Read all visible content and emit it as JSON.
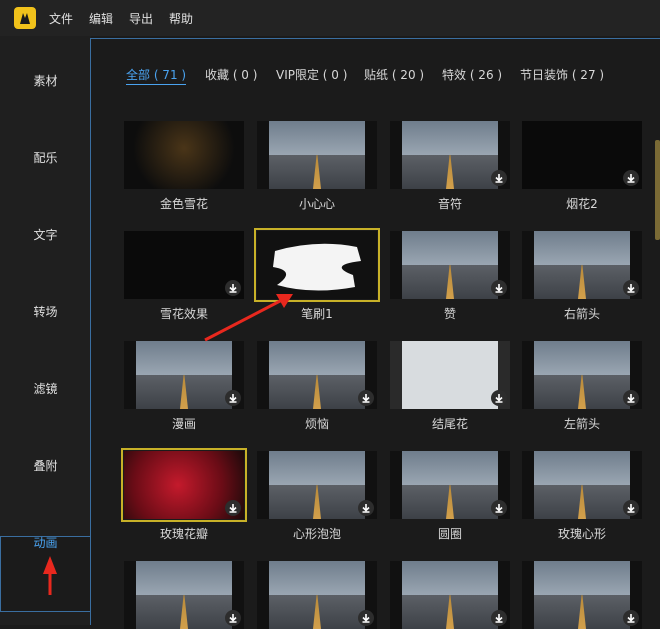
{
  "menubar": {
    "items": [
      "文件",
      "编辑",
      "导出",
      "帮助"
    ]
  },
  "sidebar": {
    "items": [
      "素材",
      "配乐",
      "文字",
      "转场",
      "滤镜",
      "叠附",
      "动画"
    ],
    "active": "动画"
  },
  "tabs": [
    {
      "label": "全部 ( 71 )",
      "active": true
    },
    {
      "label": "收藏 ( 0 )"
    },
    {
      "label": "VIP限定 ( 0 )"
    },
    {
      "label": "贴纸 ( 20 )"
    },
    {
      "label": "特效 ( 26 )"
    },
    {
      "label": "节日装饰 ( 27 )"
    }
  ],
  "tiles": [
    {
      "label": "金色雪花",
      "style": "dark-gold",
      "download": false
    },
    {
      "label": "小心心",
      "style": "road",
      "download": false
    },
    {
      "label": "音符",
      "style": "road",
      "download": true
    },
    {
      "label": "烟花2",
      "style": "dark",
      "download": true
    },
    {
      "label": "雪花效果",
      "style": "dark",
      "download": true
    },
    {
      "label": "笔刷1",
      "style": "brush",
      "download": false,
      "selected": true
    },
    {
      "label": "赞",
      "style": "road",
      "download": true
    },
    {
      "label": "右箭头",
      "style": "road",
      "download": true
    },
    {
      "label": "漫画",
      "style": "road",
      "download": true
    },
    {
      "label": "烦恼",
      "style": "road",
      "download": true
    },
    {
      "label": "结尾花",
      "style": "light",
      "download": true
    },
    {
      "label": "左箭头",
      "style": "road",
      "download": true
    },
    {
      "label": "玫瑰花瓣",
      "style": "red",
      "download": true,
      "selected": true
    },
    {
      "label": "心形泡泡",
      "style": "road",
      "download": true
    },
    {
      "label": "圆圈",
      "style": "road",
      "download": true
    },
    {
      "label": "玫瑰心形",
      "style": "road",
      "download": true
    },
    {
      "label": "",
      "style": "road",
      "download": true
    },
    {
      "label": "",
      "style": "road",
      "download": true
    },
    {
      "label": "",
      "style": "road",
      "download": true
    },
    {
      "label": "",
      "style": "road",
      "download": true
    }
  ],
  "colors": {
    "accent": "#4aa3f0",
    "selection": "#c8b128",
    "annotation": "#e8281e"
  }
}
